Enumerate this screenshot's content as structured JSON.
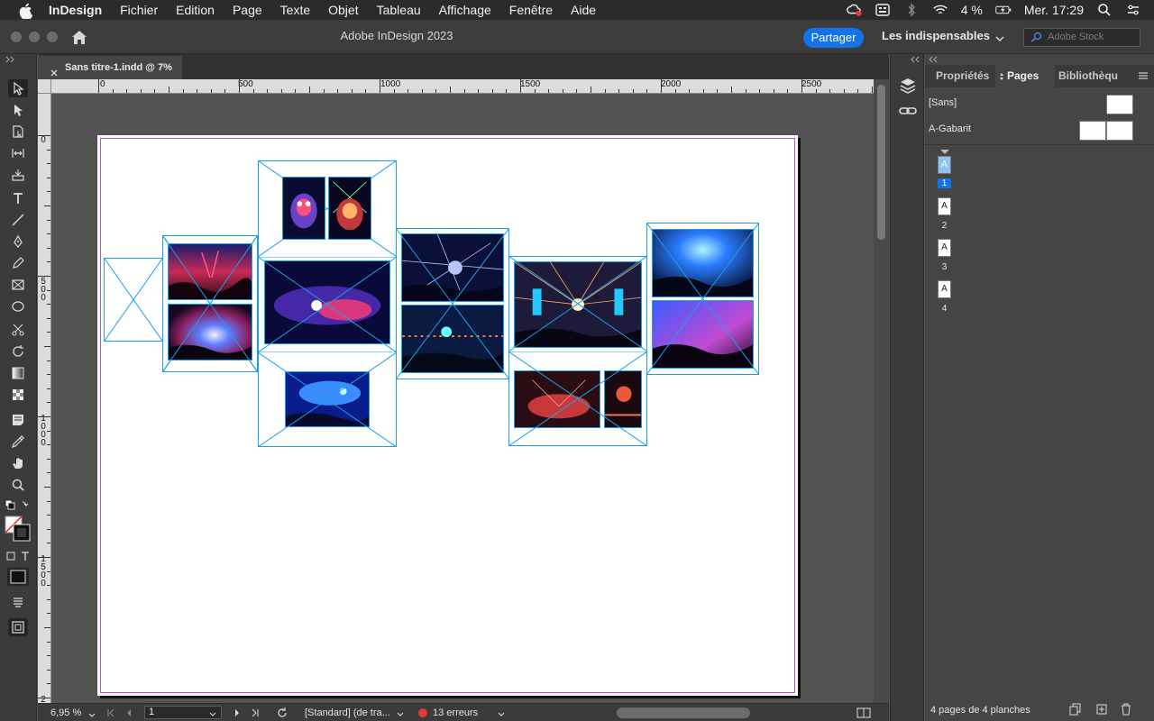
{
  "menubar": {
    "app_name": "InDesign",
    "items": [
      "Fichier",
      "Edition",
      "Page",
      "Texte",
      "Objet",
      "Tableau",
      "Affichage",
      "Fenêtre",
      "Aide"
    ],
    "battery": "4 %",
    "clock": "Mer. 17:29"
  },
  "appbar": {
    "title": "Adobe InDesign 2023",
    "share_label": "Partager",
    "workspace": "Les indispensables",
    "stock_placeholder": "Adobe Stock"
  },
  "document": {
    "tab_label": "Sans titre-1.indd @ 7%"
  },
  "rulers": {
    "horizontal": [
      "0",
      "500",
      "1000",
      "1500",
      "2000",
      "2500"
    ],
    "vertical": [
      "0",
      "500",
      "1000",
      "1500",
      "2"
    ]
  },
  "statusbar": {
    "zoom": "6,95 %",
    "page": "1",
    "preflight_profile": "[Standard] (de tra...",
    "errors": "13 erreurs"
  },
  "panel": {
    "tabs": [
      "Propriétés",
      "Pages",
      "Bibliothèqu"
    ],
    "active_tab": "Pages",
    "masters": [
      {
        "label": "[Sans]"
      },
      {
        "label": "A-Gabarit"
      }
    ],
    "pages": [
      {
        "prefix": "A",
        "number": "1",
        "selected": true
      },
      {
        "prefix": "A",
        "number": "2",
        "selected": false
      },
      {
        "prefix": "A",
        "number": "3",
        "selected": false
      },
      {
        "prefix": "A",
        "number": "4",
        "selected": false
      }
    ],
    "footer": "4 pages de 4 planches"
  },
  "colors": {
    "frame": "#1aa0e8",
    "margin": "#c24ad3",
    "accent": "#1473e6",
    "error": "#e23a3a"
  }
}
